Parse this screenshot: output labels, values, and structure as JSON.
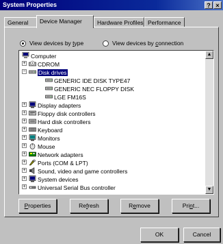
{
  "window": {
    "title": "System Properties",
    "help_glyph": "?",
    "close_glyph": "×"
  },
  "tabs": [
    {
      "label": "General"
    },
    {
      "label": "Device Manager"
    },
    {
      "label": "Hardware Profiles"
    },
    {
      "label": "Performance"
    }
  ],
  "view_options": {
    "by_type": {
      "label_pre": "View devices by ",
      "label_key": "t",
      "label_post": "ype",
      "selected": true
    },
    "by_connection": {
      "label_pre": "View devices by ",
      "label_key": "c",
      "label_post": "onnection",
      "selected": false
    }
  },
  "tree": {
    "selected_item": "Disk drives",
    "items": [
      {
        "label": "Computer",
        "icon": "computer-icon",
        "level": 0,
        "expander": "-"
      },
      {
        "label": "CDROM",
        "icon": "cdrom-icon",
        "level": 1,
        "expander": "+"
      },
      {
        "label": "Disk drives",
        "icon": "disk-drive-icon",
        "level": 1,
        "expander": "-"
      },
      {
        "label": "GENERIC IDE  DISK TYPE47",
        "icon": "disk-drive-icon",
        "level": 2,
        "expander": ""
      },
      {
        "label": "GENERIC NEC  FLOPPY DISK",
        "icon": "disk-drive-icon",
        "level": 2,
        "expander": ""
      },
      {
        "label": "LGE FM16S",
        "icon": "disk-drive-icon",
        "level": 2,
        "expander": ""
      },
      {
        "label": "Display adapters",
        "icon": "display-icon",
        "level": 1,
        "expander": "+"
      },
      {
        "label": "Floppy disk controllers",
        "icon": "floppy-controller-icon",
        "level": 1,
        "expander": "+"
      },
      {
        "label": "Hard disk controllers",
        "icon": "hard-disk-controller-icon",
        "level": 1,
        "expander": "+"
      },
      {
        "label": "Keyboard",
        "icon": "keyboard-icon",
        "level": 1,
        "expander": "+"
      },
      {
        "label": "Monitors",
        "icon": "monitor-icon",
        "level": 1,
        "expander": "+"
      },
      {
        "label": "Mouse",
        "icon": "mouse-icon",
        "level": 1,
        "expander": "+"
      },
      {
        "label": "Network adapters",
        "icon": "network-icon",
        "level": 1,
        "expander": "+"
      },
      {
        "label": "Ports (COM & LPT)",
        "icon": "ports-icon",
        "level": 1,
        "expander": "+"
      },
      {
        "label": "Sound, video and game controllers",
        "icon": "sound-icon",
        "level": 1,
        "expander": "+"
      },
      {
        "label": "System devices",
        "icon": "system-devices-icon",
        "level": 1,
        "expander": "+"
      },
      {
        "label": "Universal Serial Bus controller",
        "icon": "usb-icon",
        "level": 1,
        "expander": "+"
      }
    ]
  },
  "buttons": {
    "properties": {
      "pre": "",
      "key": "P",
      "post": "roperties"
    },
    "refresh": {
      "pre": "Re",
      "key": "f",
      "post": "resh"
    },
    "remove": {
      "pre": "R",
      "key": "e",
      "post": "move"
    },
    "print": {
      "pre": "Pri",
      "key": "n",
      "post": "t..."
    },
    "ok": "OK",
    "cancel": "Cancel"
  },
  "colors": {
    "titlebar": "#00007b",
    "selection": "#00007b",
    "face": "#c0c0c0"
  }
}
